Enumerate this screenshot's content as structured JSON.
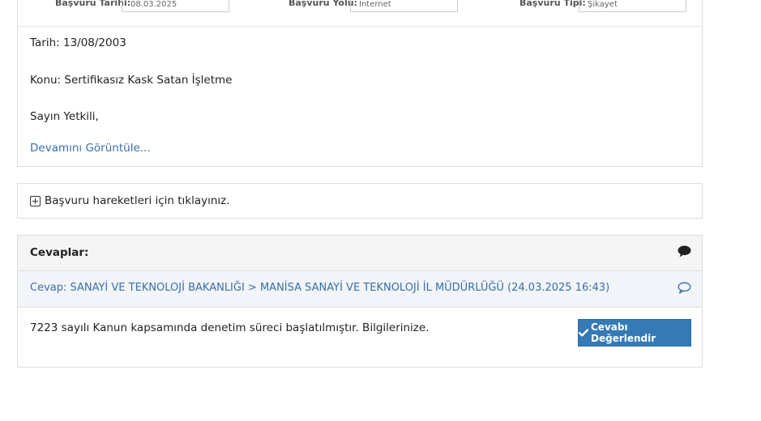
{
  "application_meta": {
    "date_label": "Başvuru Tarihi:",
    "date_value": "08.03.2025",
    "channel_label": "Başvuru Yolu:",
    "channel_value": "İnternet",
    "type_label": "Başvuru Tipi:",
    "type_value": "Şikayet"
  },
  "complaint": {
    "date_line": "Tarih: 13/08/2003",
    "subject_line": "Konu: Sertifikasız Kask Satan İşletme",
    "greeting": "Sayın Yetkili,",
    "more_link": "Devamını Görüntüle..."
  },
  "movements": {
    "label": "Başvuru hareketleri için tıklayınız."
  },
  "answers": {
    "header": "Cevaplar:",
    "header_icon": "comment-icon",
    "answer_title": "Cevap: SANAYİ VE TEKNOLOJİ BAKANLIĞI > MANİSA SANAYİ VE TEKNOLOJİ İL MÜDÜRLÜĞÜ (24.03.2025 16:43)",
    "answer_icon": "comment-outline-icon",
    "answer_text": "7223 sayılı Kanun kapsamında denetim süreci başlatılmıştır. Bilgilerinize.",
    "rate_button": "Cevabı Değerlendir",
    "rate_icon": "check-icon"
  },
  "colors": {
    "link": "#3a6fa8",
    "primary_button": "#337ab7",
    "header_bg": "#f5f5f5",
    "subheader_bg": "#f1f4f8"
  }
}
